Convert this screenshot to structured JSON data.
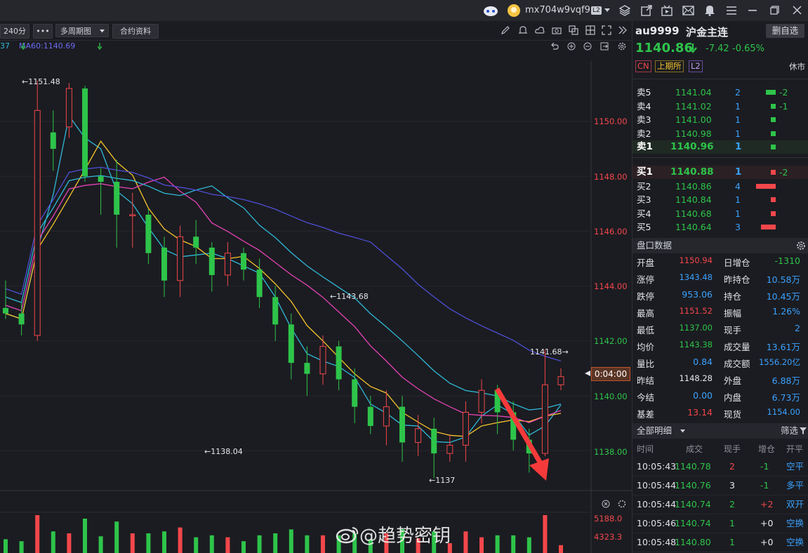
{
  "topbar": {
    "username": "mx704w9vqf9",
    "level_badge": "L2"
  },
  "toolbar": {
    "period": "240分",
    "more": "•••",
    "multi_period": "多周期图",
    "contract_info": "合约资料"
  },
  "ma_legend": {
    "partial": "37",
    "ma60": "MA60:1140.69"
  },
  "chart": {
    "price_labels": [
      "1150.00",
      "1148.00",
      "1146.00",
      "1144.00",
      "1142.00",
      "1140.00",
      "1138.00"
    ],
    "high_label": "1151.48",
    "mid_label": "1143.68",
    "low1_label": "1138.04",
    "low2_label": "1137",
    "recent_label": "1141.68",
    "countdown": "0:04:00",
    "vol_labels": [
      "5188.0",
      "4323.3"
    ],
    "watermark": "@趋势密钥",
    "colors": {
      "up": "#f2474b",
      "down": "#2ec44a",
      "ma5": "#e6e6e6",
      "ma10": "#f5c42c",
      "ma20": "#e543b4",
      "ma30": "#2fb9d8",
      "ma60": "#4e4fd6",
      "arrow": "#f53a3a"
    }
  },
  "chart_data": {
    "type": "candlestick",
    "y_ticks": [
      1150.0,
      1148.0,
      1146.0,
      1144.0,
      1142.0,
      1140.0,
      1138.0
    ],
    "annotations": [
      1151.48,
      1143.68,
      1138.04,
      1137,
      1141.68
    ],
    "ma60": 1140.69,
    "candles": [
      [
        1143.2,
        1143.0,
        1144.2,
        1142.8
      ],
      [
        1143.0,
        1142.6,
        1143.4,
        1142.2
      ],
      [
        1142.2,
        1150.4,
        1151.48,
        1142.0
      ],
      [
        1149.6,
        1149.0,
        1150.4,
        1148.2
      ],
      [
        1149.8,
        1151.2,
        1151.4,
        1149.4
      ],
      [
        1151.2,
        1148.0,
        1151.3,
        1147.8
      ],
      [
        1148.0,
        1147.8,
        1148.3,
        1146.6
      ],
      [
        1147.8,
        1146.6,
        1148.6,
        1145.4
      ],
      [
        1146.6,
        1146.6,
        1147.4,
        1145.4
      ],
      [
        1146.6,
        1145.2,
        1146.8,
        1144.8
      ],
      [
        1145.4,
        1144.2,
        1145.8,
        1143.6
      ],
      [
        1144.2,
        1145.8,
        1146.2,
        1143.6
      ],
      [
        1145.8,
        1145.4,
        1146.4,
        1144.8
      ],
      [
        1145.4,
        1144.4,
        1145.6,
        1143.8
      ],
      [
        1144.4,
        1145.2,
        1145.6,
        1144.0
      ],
      [
        1145.2,
        1144.6,
        1145.4,
        1144.2
      ],
      [
        1144.6,
        1143.6,
        1145.0,
        1143.2
      ],
      [
        1143.6,
        1142.6,
        1144.0,
        1142.0
      ],
      [
        1142.6,
        1141.2,
        1143.0,
        1140.6
      ],
      [
        1141.2,
        1140.8,
        1141.8,
        1140.0
      ],
      [
        1140.8,
        1141.8,
        1142.2,
        1140.4
      ],
      [
        1141.8,
        1140.6,
        1142.0,
        1140.2
      ],
      [
        1140.6,
        1139.6,
        1141.0,
        1139.0
      ],
      [
        1139.6,
        1138.9,
        1140.0,
        1138.6
      ],
      [
        1138.9,
        1139.6,
        1140.2,
        1138.2
      ],
      [
        1139.6,
        1138.3,
        1140.0,
        1137.6
      ],
      [
        1138.3,
        1138.8,
        1139.3,
        1137.8
      ],
      [
        1138.8,
        1137.9,
        1139.2,
        1137.0
      ],
      [
        1137.9,
        1138.2,
        1138.6,
        1137.6
      ],
      [
        1138.2,
        1139.4,
        1139.8,
        1137.6
      ],
      [
        1139.4,
        1140.2,
        1140.6,
        1139.0
      ],
      [
        1140.2,
        1139.4,
        1140.4,
        1138.6
      ],
      [
        1139.4,
        1138.4,
        1139.8,
        1138.0
      ],
      [
        1138.4,
        1137.9,
        1138.8,
        1137.2
      ],
      [
        1137.9,
        1140.4,
        1141.68,
        1137.8
      ],
      [
        1140.4,
        1140.7,
        1141.0,
        1140.2
      ]
    ]
  },
  "quote": {
    "code": "au9999",
    "name": "沪金主连",
    "delete_btn": "删自选",
    "price": "1140.86",
    "change": "-7.42",
    "change_pct": "-0.65%",
    "badges": [
      "CN",
      "上期所",
      "L2"
    ],
    "status": "休市"
  },
  "orderbook": {
    "asks": [
      {
        "label": "卖5",
        "price": "1141.04",
        "vol": "2",
        "chg": "-2",
        "bar": 14
      },
      {
        "label": "卖4",
        "price": "1141.02",
        "vol": "1",
        "chg": "-1",
        "bar": 7
      },
      {
        "label": "卖3",
        "price": "1141.00",
        "vol": "1",
        "chg": "",
        "bar": 7
      },
      {
        "label": "卖2",
        "price": "1140.98",
        "vol": "1",
        "chg": "",
        "bar": 7
      },
      {
        "label": "卖1",
        "price": "1140.96",
        "vol": "1",
        "chg": "",
        "bar": 7
      }
    ],
    "bids": [
      {
        "label": "买1",
        "price": "1140.88",
        "vol": "1",
        "chg": "-2",
        "bar": 7
      },
      {
        "label": "买2",
        "price": "1140.86",
        "vol": "4",
        "chg": "",
        "bar": 28
      },
      {
        "label": "买3",
        "price": "1140.84",
        "vol": "1",
        "chg": "",
        "bar": 7
      },
      {
        "label": "买4",
        "price": "1140.68",
        "vol": "1",
        "chg": "",
        "bar": 7
      },
      {
        "label": "买5",
        "price": "1140.64",
        "vol": "3",
        "chg": "",
        "bar": 21
      }
    ]
  },
  "panel": {
    "title": "盘口数据",
    "rows": [
      {
        "l1": "开盘",
        "v1": "1150.94",
        "c1": "red",
        "l2": "日增仓",
        "v2": "-1310",
        "c2": "green"
      },
      {
        "l1": "涨停",
        "v1": "1343.48",
        "c1": "blue",
        "l2": "昨持仓",
        "v2": "10.58万",
        "c2": "blue"
      },
      {
        "l1": "跌停",
        "v1": "953.06",
        "c1": "blue",
        "l2": "持仓",
        "v2": "10.45万",
        "c2": "blue"
      },
      {
        "l1": "最高",
        "v1": "1151.52",
        "c1": "red",
        "l2": "振幅",
        "v2": "1.26%",
        "c2": "blue"
      },
      {
        "l1": "最低",
        "v1": "1137.00",
        "c1": "green",
        "l2": "现手",
        "v2": "2",
        "c2": "blue"
      },
      {
        "l1": "均价",
        "v1": "1143.38",
        "c1": "green",
        "l2": "成交量",
        "v2": "13.61万",
        "c2": "blue"
      },
      {
        "l1": "量比",
        "v1": "0.84",
        "c1": "blue",
        "l2": "成交额",
        "v2": "1556.20亿",
        "c2": "blue"
      },
      {
        "l1": "昨结",
        "v1": "1148.28",
        "c1": "white",
        "l2": "外盘",
        "v2": "6.88万",
        "c2": "blue"
      },
      {
        "l1": "今结",
        "v1": "0.00",
        "c1": "blue",
        "l2": "内盘",
        "v2": "6.73万",
        "c2": "blue"
      },
      {
        "l1": "基差",
        "v1": "13.14",
        "c1": "red",
        "l2": "现货",
        "v2": "1154.00",
        "c2": "blue"
      }
    ]
  },
  "deals": {
    "title": "全部明细",
    "filter": "筛选",
    "headers": [
      "时间",
      "成交",
      "现手",
      "增仓",
      "开平"
    ],
    "rows": [
      {
        "time": "10:05:43",
        "price": "1140.78",
        "vol": "2",
        "vcol": "red",
        "add": "-1",
        "acol": "green",
        "type": "空平",
        "tcol": "blue"
      },
      {
        "time": "10:05:44",
        "price": "1140.76",
        "vol": "3",
        "vcol": "white",
        "add": "-1",
        "acol": "green",
        "type": "多平",
        "tcol": "blue"
      },
      {
        "time": "10:05:44",
        "price": "1140.74",
        "vol": "2",
        "vcol": "green",
        "add": "+2",
        "acol": "red",
        "type": "双开",
        "tcol": "blue"
      },
      {
        "time": "10:05:46",
        "price": "1140.74",
        "vol": "1",
        "vcol": "green",
        "add": "+0",
        "acol": "white",
        "type": "空换",
        "tcol": "blue"
      },
      {
        "time": "10:05:48",
        "price": "1140.80",
        "vol": "1",
        "vcol": "green",
        "add": "+0",
        "acol": "white",
        "type": "空换",
        "tcol": "blue"
      }
    ]
  }
}
